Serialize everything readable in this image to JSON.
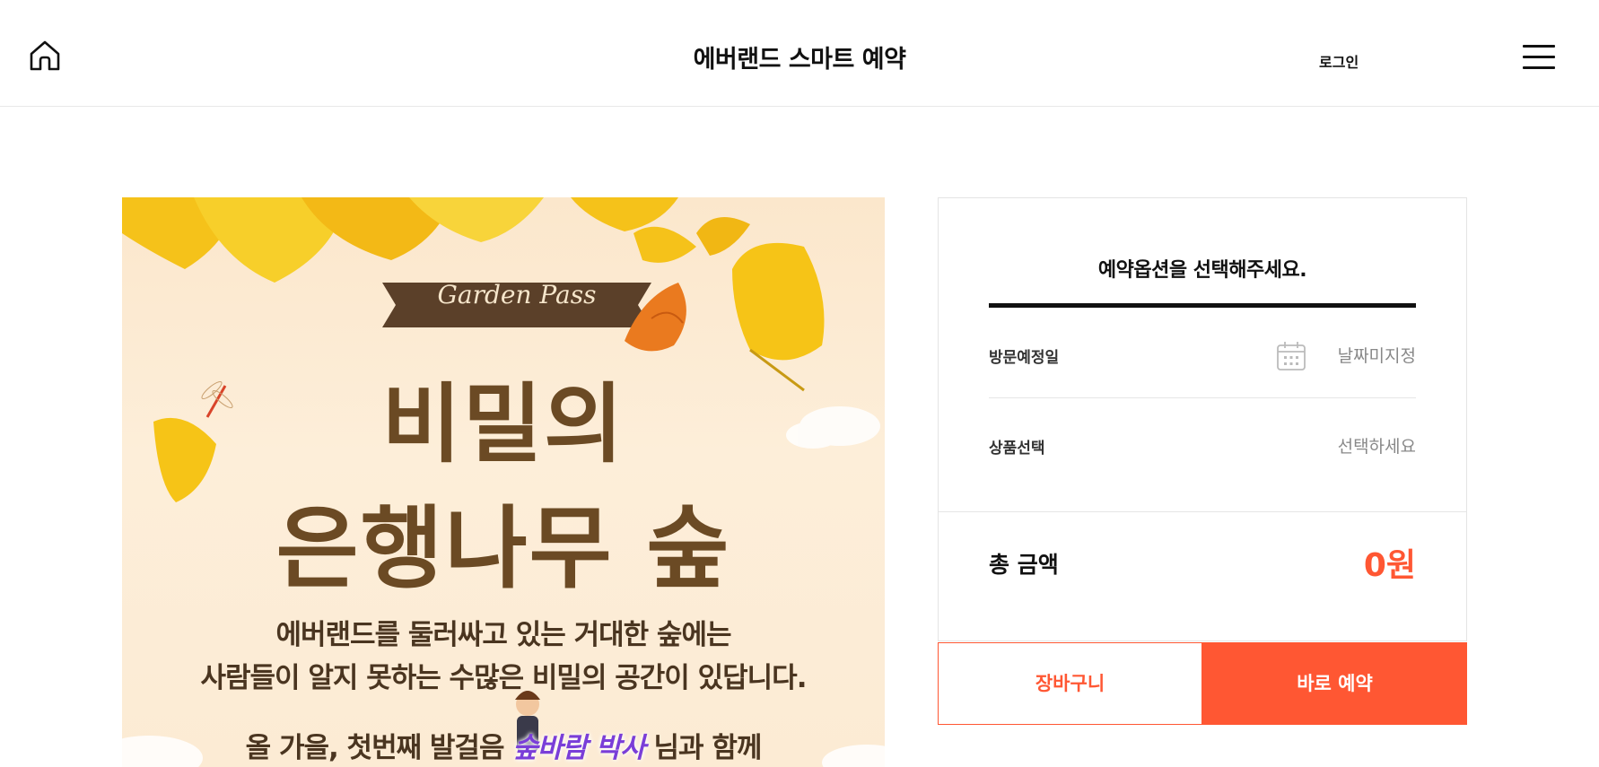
{
  "header": {
    "title": "에버랜드 스마트 예약",
    "login_label": "로그인",
    "home_icon": "home-icon",
    "menu_icon": "hamburger-menu-icon"
  },
  "banner": {
    "ribbon_text": "Garden Pass",
    "title_line1": "비밀의",
    "title_line2": "은행나무 숲",
    "text_line1": "에버랜드를 둘러싸고 있는 거대한 숲에는",
    "text_line2": "사람들이 알지 못하는 수많은 비밀의 공간이 있답니다.",
    "text_line3_before": "올 가을, 첫번째 발걸음",
    "text_line3_nick": "숲바람 박사",
    "text_line3_after": "님과 함께"
  },
  "panel": {
    "heading": "예약옵션을 선택해주세요.",
    "date_label": "방문예정일",
    "date_value": "날짜미지정",
    "product_label": "상품선택",
    "product_value": "선택하세요",
    "total_label": "총 금액",
    "total_value": "0원"
  },
  "buttons": {
    "cart_label": "장바구니",
    "book_label": "바로 예약"
  },
  "colors": {
    "accent": "#ff5733",
    "text": "#111111",
    "muted": "#888888"
  }
}
